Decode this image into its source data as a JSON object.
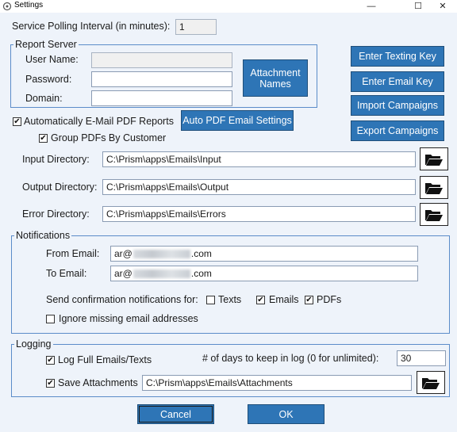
{
  "window": {
    "title": "Settings",
    "minimize": "—",
    "maximize": "☐",
    "close": "✕"
  },
  "polling": {
    "label": "Service Polling Interval (in minutes):",
    "value": "1"
  },
  "report_server": {
    "legend": "Report Server",
    "user_name_label": "User Name:",
    "password_label": "Password:",
    "domain_label": "Domain:",
    "user_name_value": "",
    "password_value": "",
    "domain_value": "",
    "attachment_names_button": "Attachment Names"
  },
  "side_buttons": {
    "texting_key": "Enter Texting Key",
    "email_key": "Enter Email Key",
    "import_campaigns": "Import Campaigns",
    "export_campaigns": "Export Campaigns"
  },
  "pdf": {
    "auto_email_label": "Automatically E-Mail PDF Reports",
    "auto_email_checked": true,
    "group_label": "Group PDFs By Customer",
    "group_checked": true,
    "auto_settings_button": "Auto PDF Email Settings"
  },
  "directories": {
    "input_label": "Input Directory:",
    "input_value": "C:\\Prism\\apps\\Emails\\Input",
    "output_label": "Output Directory:",
    "output_value": "C:\\Prism\\apps\\Emails\\Output",
    "error_label": "Error Directory:",
    "error_value": "C:\\Prism\\apps\\Emails\\Errors"
  },
  "notifications": {
    "legend": "Notifications",
    "from_label": "From Email:",
    "from_prefix": "ar@",
    "from_suffix": ".com",
    "to_label": "To Email:",
    "to_prefix": "ar@",
    "to_suffix": ".com",
    "confirm_label": "Send confirmation notifications for:",
    "texts_label": "Texts",
    "texts_checked": false,
    "emails_label": "Emails",
    "emails_checked": true,
    "pdfs_label": "PDFs",
    "pdfs_checked": true,
    "ignore_label": "Ignore missing email addresses",
    "ignore_checked": false
  },
  "logging": {
    "legend": "Logging",
    "log_full_label": "Log Full Emails/Texts",
    "log_full_checked": true,
    "days_label": "# of days to keep in log (0 for unlimited):",
    "days_value": "30",
    "save_attachments_label": "Save Attachments",
    "save_attachments_checked": true,
    "attachments_path": "C:\\Prism\\apps\\Emails\\Attachments"
  },
  "footer": {
    "cancel": "Cancel",
    "ok": "OK"
  },
  "icons": {
    "folder": "folder-open-icon",
    "app": "settings-app-icon"
  },
  "colors": {
    "background": "#eef3fa",
    "button": "#2e75b6",
    "group_border": "#5b8cc9"
  }
}
